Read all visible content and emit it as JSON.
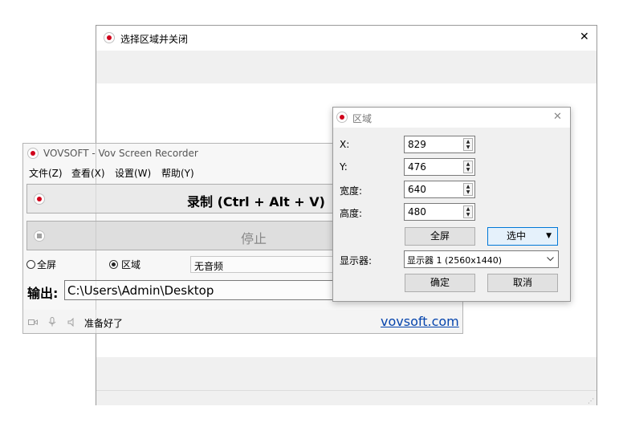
{
  "overlay_window": {
    "title": "选择区域并关闭",
    "close_glyph": "✕"
  },
  "main_window": {
    "title": "VOVSOFT - Vov Screen Recorder",
    "menu": [
      "文件(Z)",
      "查看(X)",
      "设置(W)",
      "帮助(Y)"
    ],
    "record_label": "录制 (Ctrl + Alt + V)",
    "stop_label": "停止",
    "fullscreen_label": "全屏",
    "region_label": "区域",
    "audio_value": "无音频",
    "output_label": "输出:",
    "output_path": "C:\\Users\\Admin\\Desktop",
    "status_text": "准备好了",
    "link": "vovsoft.com",
    "region_selected": true
  },
  "region_dialog": {
    "title": "区域",
    "close_glyph": "✕",
    "x_label": "X:",
    "x_value": "829",
    "y_label": "Y:",
    "y_value": "476",
    "width_label": "宽度:",
    "width_value": "640",
    "height_label": "高度:",
    "height_value": "480",
    "fullscreen_button": "全屏",
    "select_button": "选中",
    "select_arrow": "▼",
    "monitor_label": "显示器:",
    "monitor_value": "显示器 1 (2560x1440)",
    "ok_button": "确定",
    "cancel_button": "取消"
  },
  "colors": {
    "record_red": "#d0021b",
    "link_blue": "#0645ad",
    "focus_blue": "#0078d7"
  }
}
